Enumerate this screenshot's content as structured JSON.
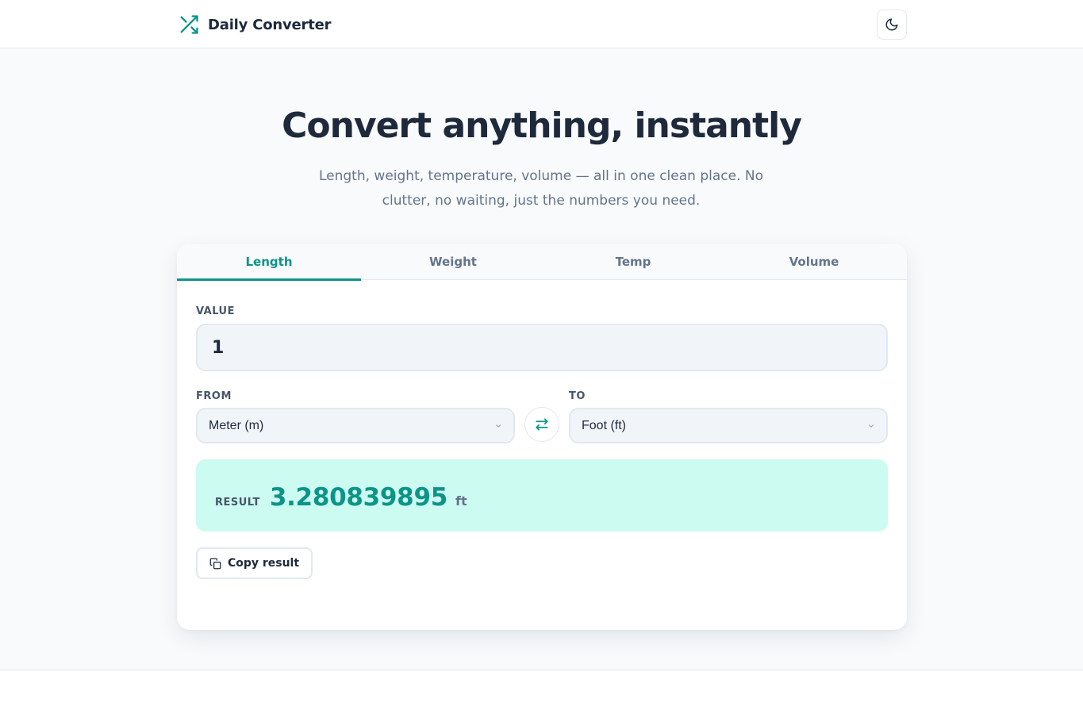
{
  "header": {
    "brand_name": "Daily Converter",
    "brand_icon": "shuffle-icon",
    "theme_toggle_icon": "moon-icon"
  },
  "hero": {
    "title": "Convert anything, instantly",
    "subtitle": "Length, weight, temperature, volume — all in one clean place. No clutter, no waiting, just the numbers you need."
  },
  "tabs": [
    {
      "label": "Length",
      "active": true
    },
    {
      "label": "Weight",
      "active": false
    },
    {
      "label": "Temp",
      "active": false
    },
    {
      "label": "Volume",
      "active": false
    }
  ],
  "converter": {
    "value_label": "VALUE",
    "value": "1",
    "from_label": "FROM",
    "from_selected": "Meter (m)",
    "to_label": "TO",
    "to_selected": "Foot (ft)",
    "swap_icon": "swap-arrows-icon"
  },
  "result": {
    "label": "RESULT",
    "value": "3.280839895",
    "unit": "ft"
  },
  "copy": {
    "label": "Copy result",
    "icon": "copy-icon"
  },
  "colors": {
    "accent": "#0d9488",
    "result_background": "#ccfbf1",
    "heading": "#1e293b",
    "muted": "#64748b"
  }
}
